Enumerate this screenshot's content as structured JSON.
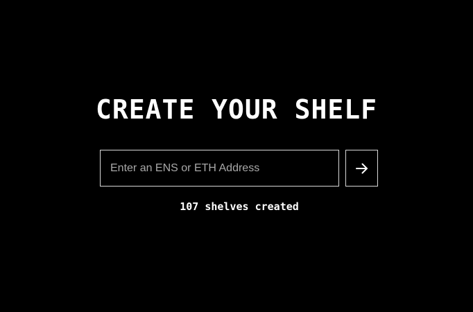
{
  "heading": {
    "title": "CREATE YOUR SHELF"
  },
  "form": {
    "address_placeholder": "Enter an ENS or ETH Address",
    "address_value": "",
    "submit_icon": "arrow-right-icon"
  },
  "stats": {
    "shelves_created_text": "107 shelves created"
  },
  "colors": {
    "background": "#000000",
    "text": "#ffffff",
    "border": "#d9d9d9",
    "placeholder": "#a8a8a8"
  }
}
